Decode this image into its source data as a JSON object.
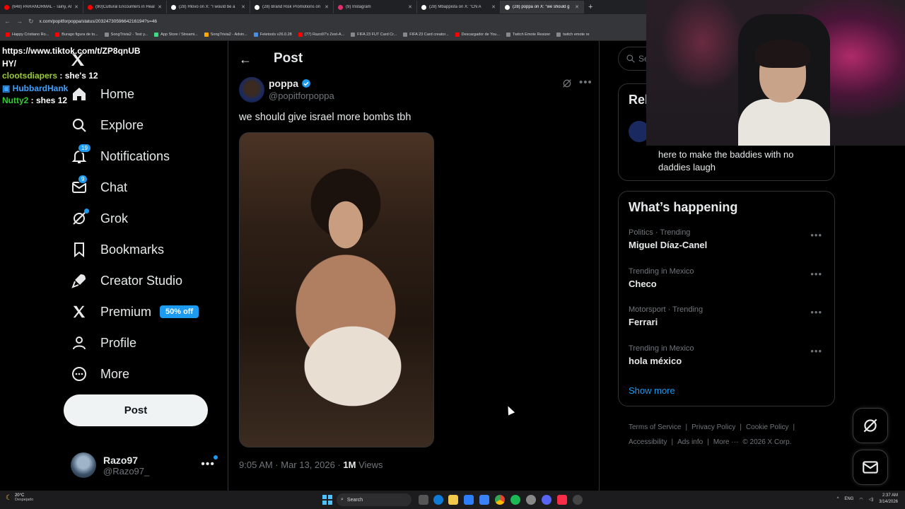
{
  "browser": {
    "tabs": [
      {
        "label": "(648) PARANORMAL - Tainy, Al",
        "color": "#ff0000"
      },
      {
        "label": "(90)Cultural Encounters in Heal",
        "color": "#ff0000"
      },
      {
        "label": "(28) Hlovo on X: \"I would be a",
        "color": "#ffffff"
      },
      {
        "label": "(28) Brand Risk Promotions on",
        "color": "#ffffff"
      },
      {
        "label": "(9) Instagram",
        "color": "#e1306c"
      },
      {
        "label": "(28) Mbappista on X: \"CN A",
        "color": "#ffffff"
      },
      {
        "label": "(28) poppa on X: \"we should g",
        "color": "#ffffff",
        "active": true
      }
    ],
    "new_tab": "+",
    "url": "x.com/popitforpoppa/status/2032473059664216194?s=46",
    "bookmarks": [
      {
        "label": "Happy Cristiano Ro...",
        "color": "#ff0000"
      },
      {
        "label": "Burago figura de to...",
        "color": "#ff0000"
      },
      {
        "label": "SongTrivia2 - Test y...",
        "color": "#888"
      },
      {
        "label": "App Store / Streami...",
        "color": "#3ddc84"
      },
      {
        "label": "SongTrivia2 - Advin...",
        "color": "#ffaa00"
      },
      {
        "label": "Feletools v26.0.28",
        "color": "#4a90e2"
      },
      {
        "label": "(77) Razo97's Zest-A...",
        "color": "#ff0000"
      },
      {
        "label": "FIFA 23 FUT Card Cr...",
        "color": "#888"
      },
      {
        "label": "FIFA 23 Card creator...",
        "color": "#888"
      },
      {
        "label": "Descargador de You...",
        "color": "#ff0000"
      },
      {
        "label": "Twitch Emote Resizer",
        "color": "#888"
      },
      {
        "label": "twitch emote re",
        "color": "#888"
      }
    ]
  },
  "chat": {
    "url_line1": "https://www.tiktok.com/t/ZP8qnUB",
    "url_line2": "HY/",
    "messages": [
      {
        "user": "clootsdiapers",
        "text": " : she's 12"
      },
      {
        "user": "HubbardHank",
        "text": ""
      },
      {
        "user": "Nutty2",
        "text": " : shes 12"
      }
    ]
  },
  "nav": {
    "items": [
      {
        "label": "Home",
        "icon": "home-icon"
      },
      {
        "label": "Explore",
        "icon": "search-icon"
      },
      {
        "label": "Notifications",
        "icon": "bell-icon",
        "badge": "19"
      },
      {
        "label": "Chat",
        "icon": "mail-icon",
        "badge": "9"
      },
      {
        "label": "Grok",
        "icon": "grok-icon"
      },
      {
        "label": "Bookmarks",
        "icon": "bookmark-icon"
      },
      {
        "label": "Creator Studio",
        "icon": "rocket-icon"
      },
      {
        "label": "Premium",
        "icon": "x-logo-icon",
        "pill": "50% off"
      },
      {
        "label": "Profile",
        "icon": "person-icon"
      },
      {
        "label": "More",
        "icon": "more-circle-icon"
      }
    ],
    "post_button": "Post",
    "account": {
      "name": "Razo97",
      "handle": "@Razo97_",
      "more": "•••"
    }
  },
  "main": {
    "header": "Post",
    "post": {
      "author": "poppa",
      "handle": "@popitforpoppa",
      "text": "we should give israel more bombs tbh",
      "time": "9:05 AM · Mar 13, 2026 · ",
      "views_count": "1M",
      "views_label": " Views"
    }
  },
  "right": {
    "search_placeholder": "Se",
    "relevant_title": "Rel",
    "relevant_bio": "here to make the baddies with no daddies laugh",
    "happening_title": "What’s happening",
    "trends": [
      {
        "context": "Politics · Trending",
        "name": "Miguel Díaz-Canel"
      },
      {
        "context": "Trending in Mexico",
        "name": "Checo"
      },
      {
        "context": "Motorsport · Trending",
        "name": "Ferrari"
      },
      {
        "context": "Trending in Mexico",
        "name": "hola méxico"
      }
    ],
    "show_more": "Show more",
    "footer": {
      "terms": "Terms of Service",
      "privacy": "Privacy Policy",
      "cookie": "Cookie Policy",
      "accessibility": "Accessibility",
      "ads": "Ads info",
      "more": "More ···",
      "copyright": "© 2026 X Corp."
    }
  },
  "taskbar": {
    "temp": "20°C",
    "weather": "Despejado",
    "search": "Search",
    "lang": "ENG",
    "time": "2:37 AM",
    "date": "3/14/2026"
  },
  "colors": {
    "accent": "#1d9bf0",
    "bg": "#000000",
    "text": "#e7e9ea",
    "muted": "#71767b",
    "border": "#2f3336"
  }
}
